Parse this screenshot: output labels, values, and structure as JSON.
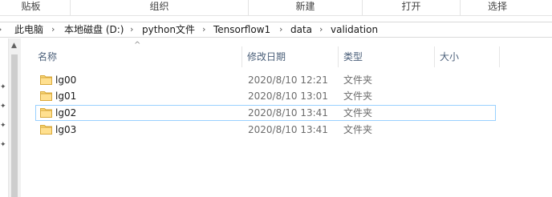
{
  "ribbon": {
    "groups": [
      "贴板",
      "组织",
      "新建",
      "打开",
      "选择"
    ]
  },
  "address": {
    "crumbs": [
      "此电脑",
      "本地磁盘 (D:)",
      "python文件",
      "Tensorflow1",
      "data",
      "validation"
    ]
  },
  "columns": {
    "name": "名称",
    "date": "修改日期",
    "type": "类型",
    "size": "大小"
  },
  "files": [
    {
      "name": "lg00",
      "date": "2020/8/10 12:21",
      "type": "文件夹"
    },
    {
      "name": "lg01",
      "date": "2020/8/10 13:01",
      "type": "文件夹"
    },
    {
      "name": "lg02",
      "date": "2020/8/10 13:41",
      "type": "文件夹"
    },
    {
      "name": "lg03",
      "date": "2020/8/10 13:41",
      "type": "文件夹"
    }
  ],
  "colors": {
    "header_text": "#4c607a",
    "focus_border": "#99d1ff",
    "folder_yellow": "#f8d775"
  },
  "icons": {
    "folder": "folder-icon",
    "sort": "sort-up-icon",
    "separator": "chevron-right-icon",
    "pin": "pin-icon"
  }
}
